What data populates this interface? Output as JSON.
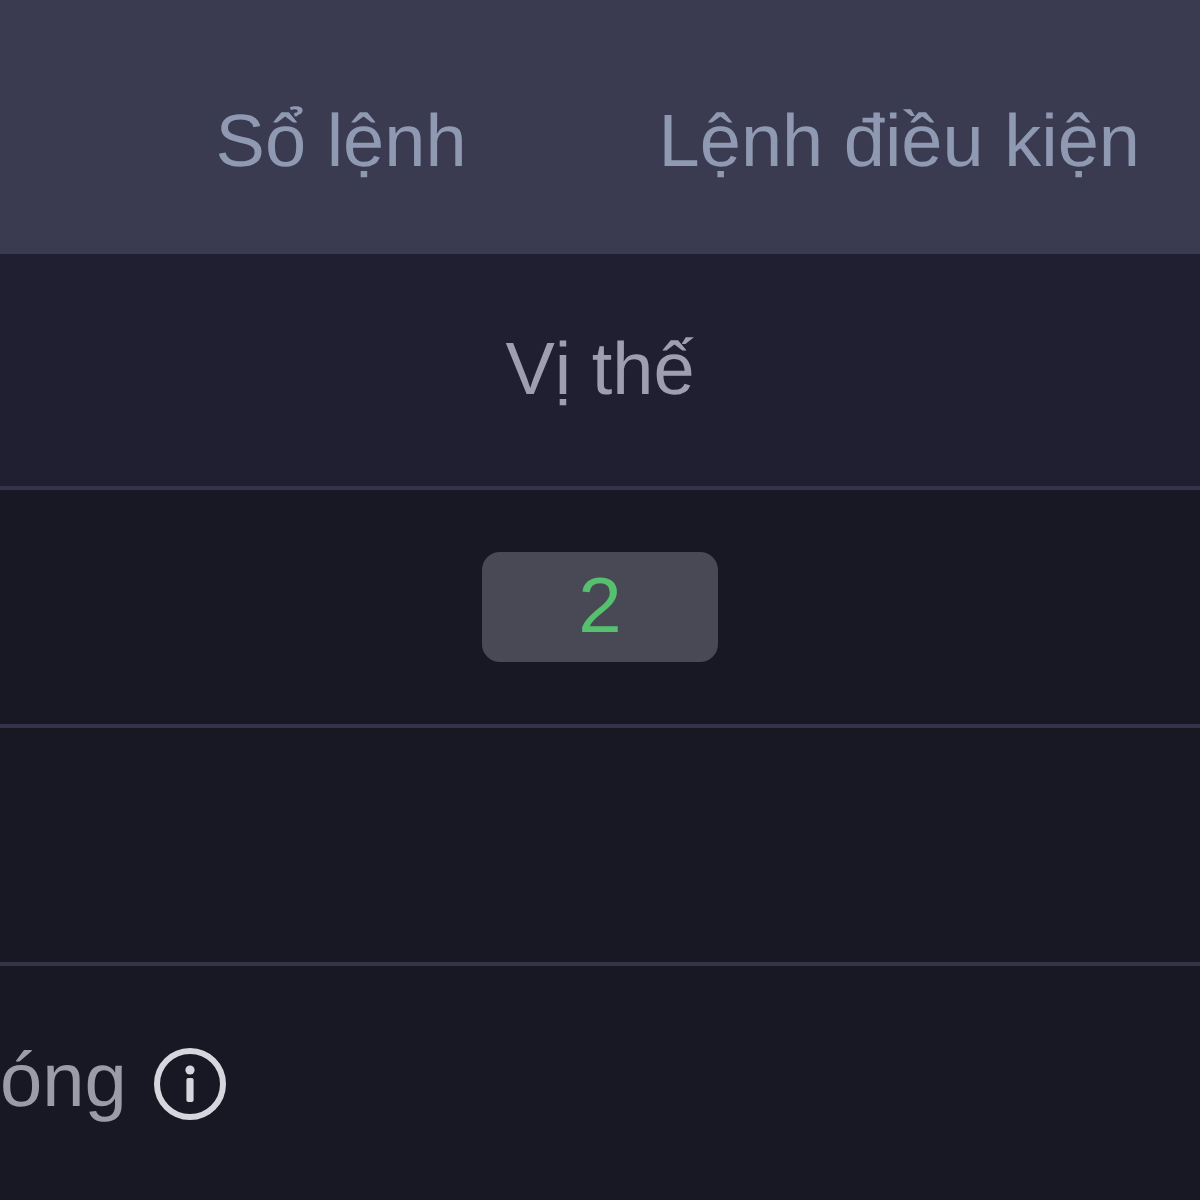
{
  "tabs": [
    {
      "label": "Sổ lệnh"
    },
    {
      "label": "Lệnh điều kiện"
    }
  ],
  "table": {
    "columns": [
      {
        "label": "Vị thế"
      }
    ],
    "rows": [
      {
        "kind": "count",
        "text": "2"
      },
      {
        "kind": "blank"
      }
    ]
  },
  "info_row": {
    "label": "óng"
  }
}
